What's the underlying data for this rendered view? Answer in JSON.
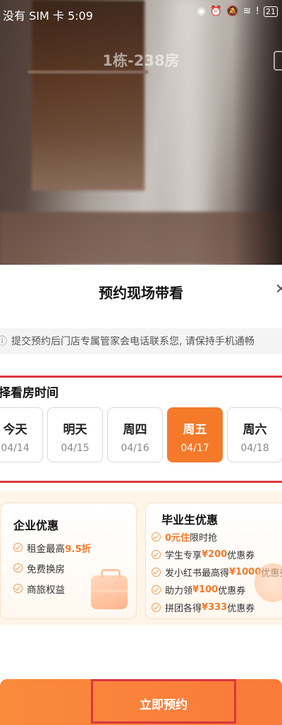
{
  "status_bar": {
    "carrier": "没有 SIM 卡",
    "time": "5:09",
    "battery": "21",
    "icons": [
      "eye-icon",
      "alarm-off-icon",
      "mute-icon",
      "wifi-icon",
      "warning-icon",
      "battery-icon"
    ]
  },
  "photo": {
    "room_title": "1栋-238房"
  },
  "sheet": {
    "title": "预约现场带看",
    "close_icon": "close-icon",
    "notice_text": "提交预约后门店专属管家会电话联系您, 请保持手机通畅"
  },
  "time_picker": {
    "header": "择看房时间",
    "days": [
      {
        "name": "今天",
        "date": "04/14",
        "selected": false
      },
      {
        "name": "明天",
        "date": "04/15",
        "selected": false
      },
      {
        "name": "周四",
        "date": "04/16",
        "selected": false
      },
      {
        "name": "周五",
        "date": "04/17",
        "selected": true
      },
      {
        "name": "周六",
        "date": "04/18",
        "selected": false
      }
    ]
  },
  "promos": {
    "enterprise": {
      "title": "企业优惠",
      "items": [
        {
          "pre": "租金最高",
          "hl": "9.5折",
          "post": ""
        },
        {
          "pre": "免费换房",
          "hl": "",
          "post": ""
        },
        {
          "pre": "商旅权益",
          "hl": "",
          "post": ""
        }
      ]
    },
    "graduate": {
      "title": "毕业生优惠",
      "items": [
        {
          "pre": "",
          "hl": "0元住",
          "post": "限时抢"
        },
        {
          "pre": "学生专享",
          "hl": "¥200",
          "post": "优惠券"
        },
        {
          "pre": "发小红书最高得",
          "hl": "¥1000",
          "post": "优惠券"
        },
        {
          "pre": "助力领",
          "hl": "¥100",
          "post": "优惠券"
        },
        {
          "pre": "拼团各得",
          "hl": "¥333",
          "post": "优惠券"
        }
      ]
    }
  },
  "cta": {
    "label": "立即预约"
  },
  "colors": {
    "accent": "#f47a2a",
    "highlight_box": "#d9363e",
    "promo_bg": "#fff5e8"
  }
}
